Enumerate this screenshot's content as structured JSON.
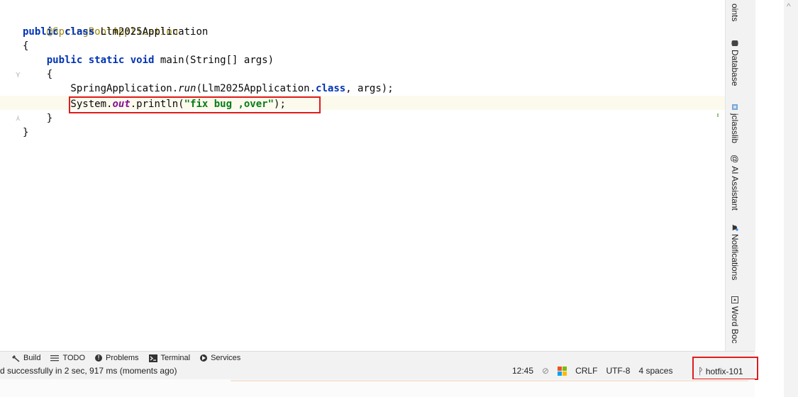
{
  "editor": {
    "lines": {
      "l1": {
        "annotation": "@SpringBootApplication"
      },
      "l2": {
        "kw1": "public",
        "kw2": "class",
        "name": " Llm2025Application"
      },
      "l3": {
        "text": "{"
      },
      "l4": {
        "indent": "    ",
        "kw1": "public",
        "kw2": "static",
        "kw3": "void",
        "rest": " main(String[] args)"
      },
      "l5": {
        "text": "    {"
      },
      "l6": {
        "prefix": "        SpringApplication.",
        "method": "run",
        "mid": "(Llm2025Application.",
        "kw": "class",
        "suffix": ", args);"
      },
      "l7": {
        "prefix": "        System.",
        "field": "out",
        "mid": ".println(",
        "str": "\"fix bug ,over\"",
        "suffix": ");"
      },
      "l8": {
        "text": "    }"
      },
      "l9": {
        "text": "}"
      }
    }
  },
  "right_tools": {
    "points": "oints",
    "database": "Database",
    "jclasslib": "jclasslib",
    "ai_assistant": "AI Assistant",
    "notifications": "Notifications",
    "word_book": "Word Boc"
  },
  "tool_bar": {
    "build": "Build",
    "todo": "TODO",
    "problems": "Problems",
    "terminal": "Terminal",
    "services": "Services"
  },
  "status_bar": {
    "message": "d successfully in 2 sec, 917 ms (moments ago)",
    "position": "12:45",
    "line_sep": "CRLF",
    "encoding": "UTF-8",
    "indent": "4 spaces",
    "branch": "hotfix-101"
  },
  "colors": {
    "highlight_box": "#e01b1b",
    "keyword": "#0033b3",
    "string": "#067d17",
    "annotation": "#9e880d",
    "field": "#871094"
  }
}
